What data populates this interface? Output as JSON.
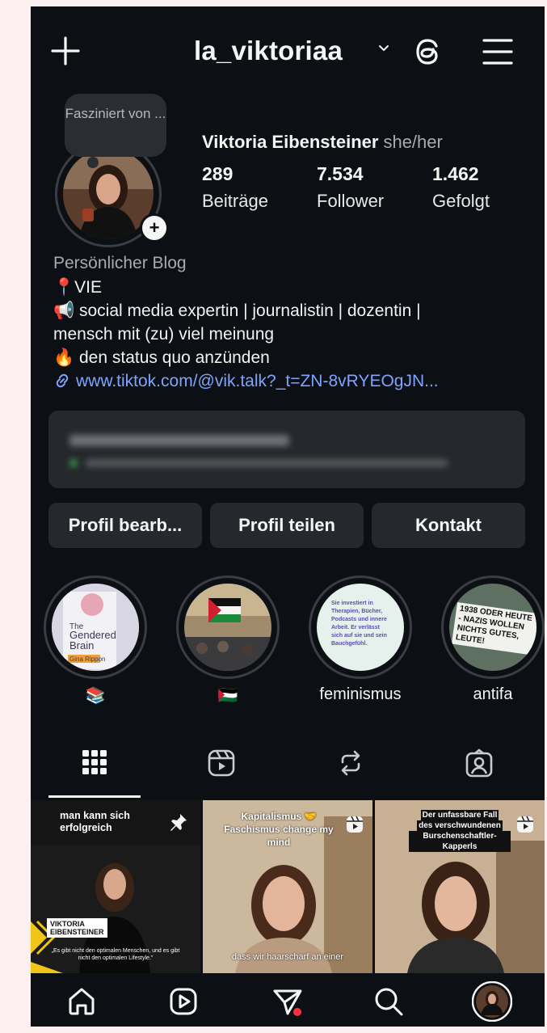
{
  "header": {
    "username": "la_viktoriaa",
    "icons": [
      "plus-icon",
      "chevron-down-icon",
      "threads-icon",
      "menu-icon"
    ]
  },
  "profile": {
    "note": "Fasziniert von ...",
    "display_name": "Viktoria Eibensteiner",
    "pronouns": "she/her",
    "stats": {
      "posts": {
        "value": "289",
        "label": "Beiträge"
      },
      "followers": {
        "value": "7.534",
        "label": "Follower"
      },
      "following": {
        "value": "1.462",
        "label": "Gefolgt"
      }
    }
  },
  "bio": {
    "category": "Persönlicher Blog",
    "line1": "📍VIE",
    "line2": "📢 social media expertin | journalistin | dozentin |",
    "line3": "mensch mit (zu) viel meinung",
    "line4": "🔥 den status quo anzünden",
    "link": "www.tiktok.com/@vik.talk?_t=ZN-8vRYEOgJN..."
  },
  "buttons": {
    "edit": "Profil bearb...",
    "share": "Profil teilen",
    "contact": "Kontakt"
  },
  "highlights": [
    {
      "label": "📚",
      "cover_text": "The Gendered Brain Gina Rippon"
    },
    {
      "label": "🇵🇸",
      "cover_text": ""
    },
    {
      "label": "feminismus",
      "cover_text": "Sie investiert in Therapien, Bücher, Podcasts und innere Arbeit. Er verlässt sich auf sie und sein Bauchgefühl."
    },
    {
      "label": "antifa",
      "cover_text": "1938 ODER HEUTE - NAZIS WOLLEN NICHTS GUTES, LEUTE!"
    }
  ],
  "tabs": [
    "grid-icon",
    "reels-icon",
    "reposts-icon",
    "tagged-icon"
  ],
  "posts": [
    {
      "caption": "man kann sich erfolgreich",
      "name_tag_1": "VIKTORIA",
      "name_tag_2": "EIBENSTEINER",
      "quote": "„Es gibt nicht den optimalen Menschen, und es gibt nicht den optimalen Lifestyle.\""
    },
    {
      "caption": "Kapitalismus 🤝 Faschismus change my mind",
      "subtitle": "dass wir haarscharf an einer"
    },
    {
      "caption_1": "Der unfassbare Fall",
      "caption_2": "des verschwundenen",
      "caption_3": "Burschenschaftler-Kapperls"
    }
  ],
  "bottom_nav": [
    "home-icon",
    "reels-icon",
    "direct-messages-icon",
    "search-icon",
    "profile-avatar"
  ],
  "colors": {
    "background": "#0c1014",
    "surface": "#25282c",
    "link": "#7ea4ff",
    "notification_dot": "#ff3040"
  }
}
